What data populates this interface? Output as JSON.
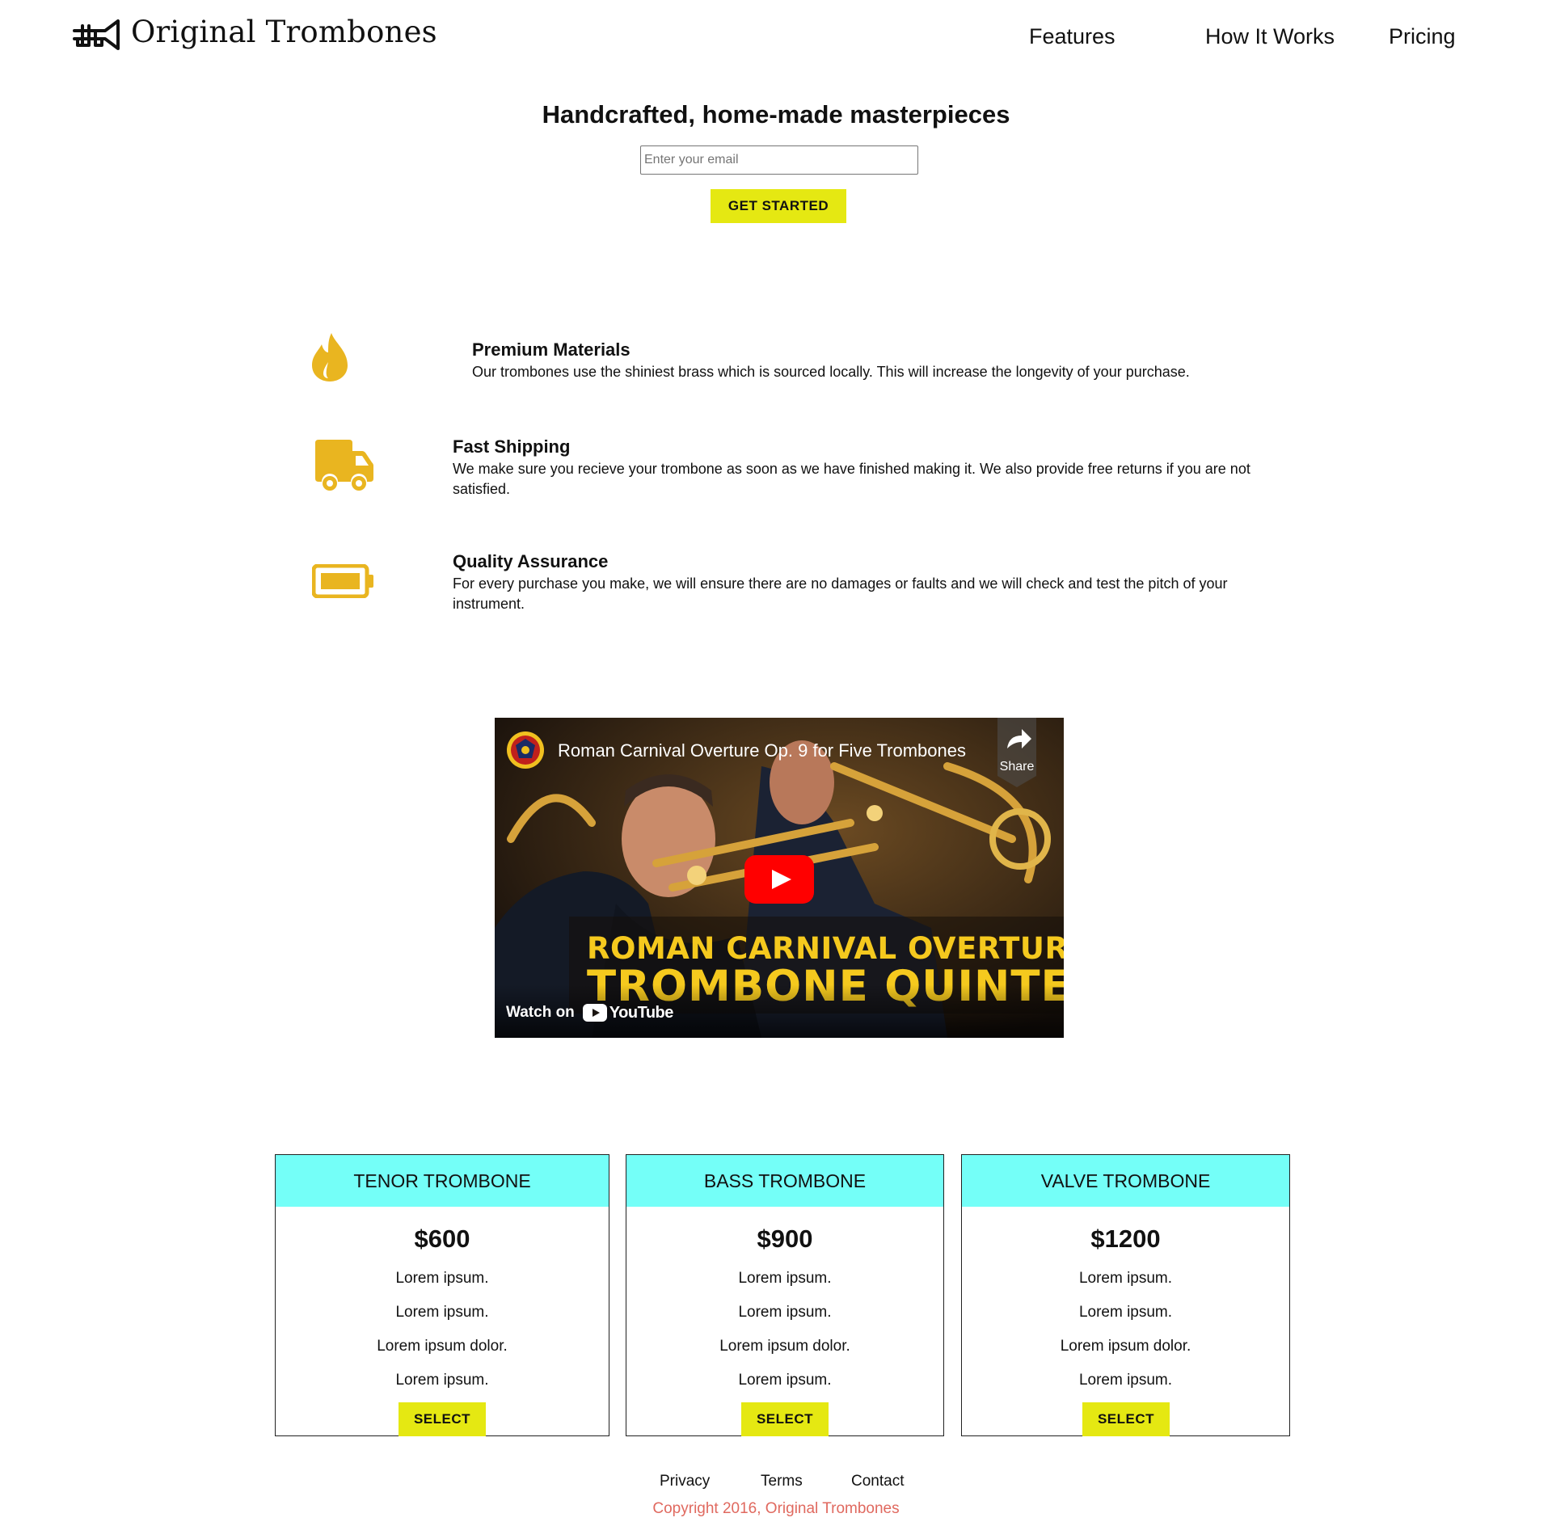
{
  "header": {
    "brand": "Original Trombones",
    "logo_icon": "trombone-icon",
    "nav": [
      {
        "label": "Features"
      },
      {
        "label": "How It Works"
      },
      {
        "label": "Pricing"
      }
    ]
  },
  "hero": {
    "title": "Handcrafted, home-made masterpieces",
    "email_placeholder": "Enter your email",
    "email_value": "",
    "cta_label": "GET STARTED",
    "cta_color": "#e5e812"
  },
  "features": [
    {
      "icon": "fire-icon",
      "title": "Premium Materials",
      "description": "Our trombones use the shiniest brass which is sourced locally. This will increase the longevity of your purchase."
    },
    {
      "icon": "truck-icon",
      "title": "Fast Shipping",
      "description": "We make sure you recieve your trombone as soon as we have finished making it. We also provide free returns if you are not satisfied."
    },
    {
      "icon": "battery-icon",
      "title": "Quality Assurance",
      "description": "For every purchase you make, we will ensure there are no damages or faults and we will check and test the pitch of your instrument."
    }
  ],
  "feature_icon_color": "#e9b520",
  "video": {
    "title": "Roman Carnival Overture Op. 9 for Five Trombones",
    "share_label": "Share",
    "caption_line1": "ROMAN CARNIVAL OVERTURE",
    "caption_line2": "TROMBONE QUINTET",
    "watch_label": "Watch on",
    "platform_label": "YouTube"
  },
  "pricing": {
    "header_color": "#74fff8",
    "plans": [
      {
        "name": "TENOR TROMBONE",
        "price": "$600",
        "features": [
          "Lorem ipsum.",
          "Lorem ipsum.",
          "Lorem ipsum dolor.",
          "Lorem ipsum."
        ],
        "button": "SELECT"
      },
      {
        "name": "BASS TROMBONE",
        "price": "$900",
        "features": [
          "Lorem ipsum.",
          "Lorem ipsum.",
          "Lorem ipsum dolor.",
          "Lorem ipsum."
        ],
        "button": "SELECT"
      },
      {
        "name": "VALVE TROMBONE",
        "price": "$1200",
        "features": [
          "Lorem ipsum.",
          "Lorem ipsum.",
          "Lorem ipsum dolor.",
          "Lorem ipsum."
        ],
        "button": "SELECT"
      }
    ]
  },
  "footer": {
    "links": [
      {
        "label": "Privacy"
      },
      {
        "label": "Terms"
      },
      {
        "label": "Contact"
      }
    ],
    "copyright": "Copyright 2016, Original Trombones",
    "copyright_color": "#e0695f"
  }
}
